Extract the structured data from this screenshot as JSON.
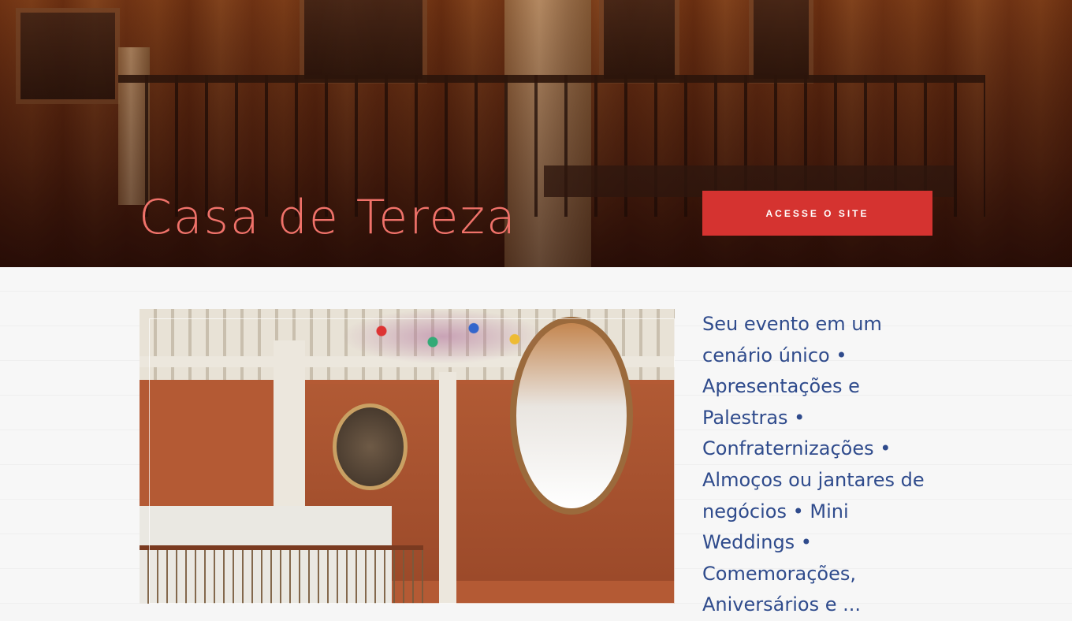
{
  "hero": {
    "title": "Casa de Tereza",
    "button_label": "ACESSE O SITE"
  },
  "content": {
    "description": "Seu evento em um cenário único • Apresentações e Palestras • Confraternizações • Almoços ou jantares de negócios • Mini Weddings • Comemorações, Aniversários e ..."
  },
  "colors": {
    "title": "#f0726a",
    "button_bg": "#d53330",
    "description_text": "#2f4b8c"
  },
  "icons": []
}
